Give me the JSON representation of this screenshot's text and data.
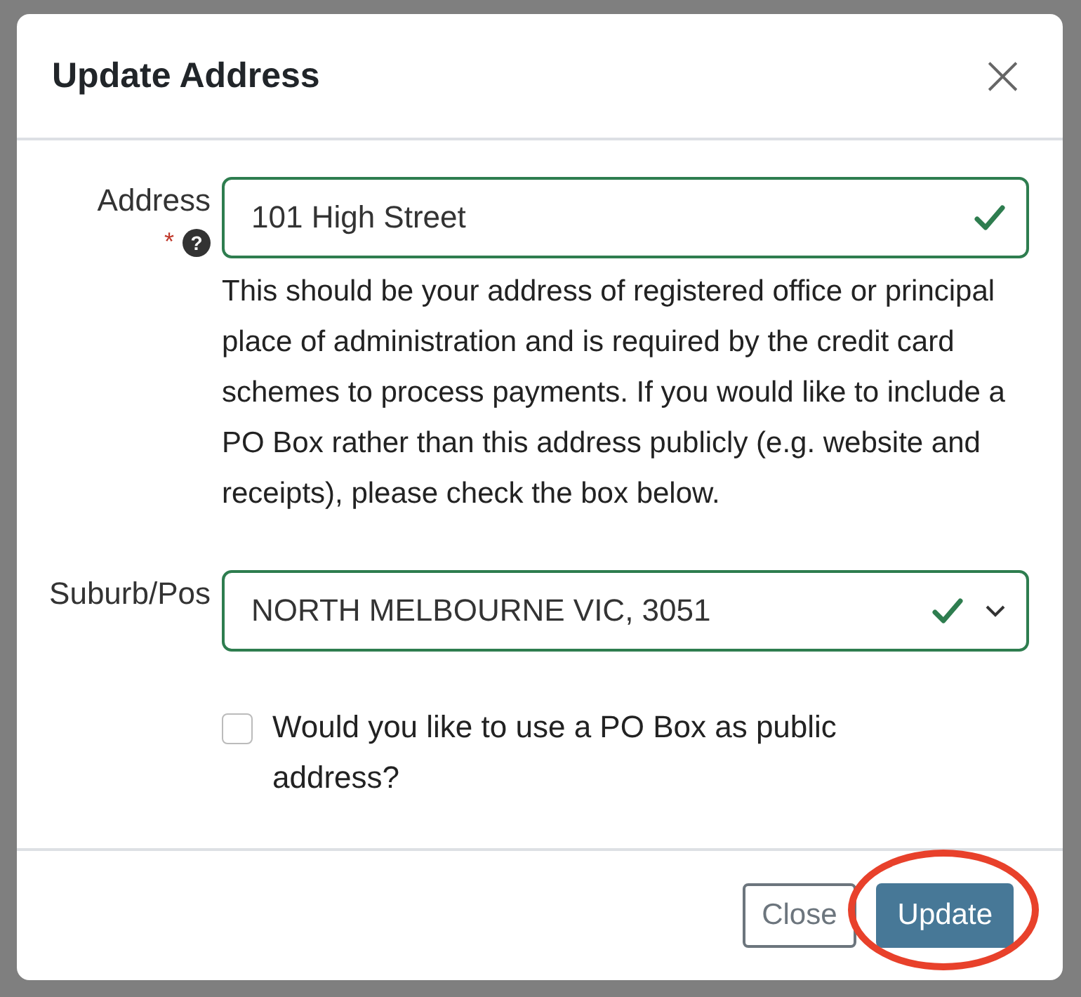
{
  "dialog": {
    "title": "Update Address",
    "close_icon": "×",
    "fields": [
      {
        "kind": "text",
        "label": "Address",
        "required_mark": "*",
        "help_icon": "?",
        "value": "101 High Street",
        "valid": true,
        "help_text": "This should be your address of registered office or principal place of administration and is required by the credit card schemes to process payments. If you would like to include a PO Box rather than this address publicly (e.g. website and receipts), please check the box below."
      },
      {
        "kind": "select",
        "label": "Suburb/Pos",
        "value": "NORTH MELBOURNE VIC, 3051",
        "valid": true
      }
    ],
    "checkbox": {
      "label": "Would you like to use a PO Box as public address?",
      "checked": false
    },
    "buttons": [
      {
        "label": "Close",
        "kind": "secondary",
        "circled": false
      },
      {
        "label": "Update",
        "kind": "primary",
        "circled": true
      }
    ]
  }
}
